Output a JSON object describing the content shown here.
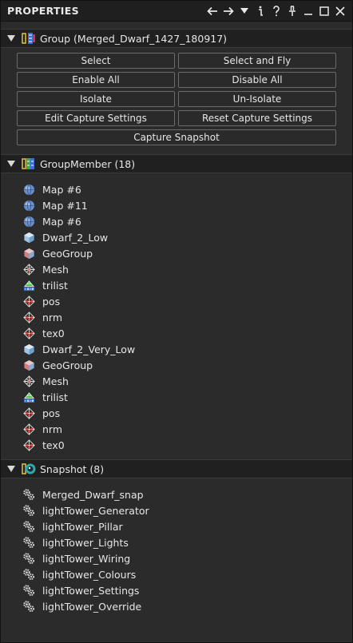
{
  "window": {
    "title": "PROPERTIES",
    "icons": [
      "arrow-left-icon",
      "arrow-right-icon",
      "dropdown-icon",
      "info-icon",
      "help-icon",
      "pin-icon",
      "minimize-icon",
      "maximize-icon",
      "close-icon"
    ]
  },
  "group": {
    "header": "Group (Merged_Dwarf_1427_180917)",
    "buttons": {
      "select": "Select",
      "select_and_fly": "Select and Fly",
      "enable_all": "Enable All",
      "disable_all": "Disable All",
      "isolate": "Isolate",
      "un_isolate": "Un-Isolate",
      "edit_capture": "Edit Capture Settings",
      "reset_capture": "Reset Capture Settings",
      "capture_snapshot": "Capture Snapshot"
    }
  },
  "group_member": {
    "header": "GroupMember (18)",
    "items": [
      {
        "label": "Map #6",
        "icon": "globe-icon"
      },
      {
        "label": "Map #11",
        "icon": "globe-icon"
      },
      {
        "label": "Map #6",
        "icon": "globe-icon"
      },
      {
        "label": "Dwarf_2_Low",
        "icon": "cube-icon"
      },
      {
        "label": "GeoGroup",
        "icon": "geogroup-icon"
      },
      {
        "label": "Mesh",
        "icon": "mesh-icon"
      },
      {
        "label": "trilist",
        "icon": "trilist-icon"
      },
      {
        "label": "pos",
        "icon": "vertex-array-icon"
      },
      {
        "label": "nrm",
        "icon": "vertex-array-icon"
      },
      {
        "label": "tex0",
        "icon": "vertex-array-icon"
      },
      {
        "label": "Dwarf_2_Very_Low",
        "icon": "cube-icon"
      },
      {
        "label": "GeoGroup",
        "icon": "geogroup-icon"
      },
      {
        "label": "Mesh",
        "icon": "mesh-icon"
      },
      {
        "label": "trilist",
        "icon": "trilist-icon"
      },
      {
        "label": "pos",
        "icon": "vertex-array-icon"
      },
      {
        "label": "nrm",
        "icon": "vertex-array-icon"
      },
      {
        "label": "tex0",
        "icon": "vertex-array-icon"
      }
    ]
  },
  "snapshot": {
    "header": "Snapshot (8)",
    "items": [
      {
        "label": "Merged_Dwarf_snap",
        "icon": "gears-icon"
      },
      {
        "label": "lightTower_Generator",
        "icon": "gears-icon"
      },
      {
        "label": "lightTower_Pillar",
        "icon": "gears-icon"
      },
      {
        "label": "lightTower_Lights",
        "icon": "gears-icon"
      },
      {
        "label": "lightTower_Wiring",
        "icon": "gears-icon"
      },
      {
        "label": "lightTower_Colours",
        "icon": "gears-icon"
      },
      {
        "label": "lightTower_Settings",
        "icon": "gears-icon"
      },
      {
        "label": "lightTower_Override",
        "icon": "gears-icon"
      }
    ]
  },
  "colors": {
    "background": "#2b2b2b",
    "header_background": "#202020",
    "button_border": "#6a6a6a",
    "text": "#e6e6e6"
  }
}
